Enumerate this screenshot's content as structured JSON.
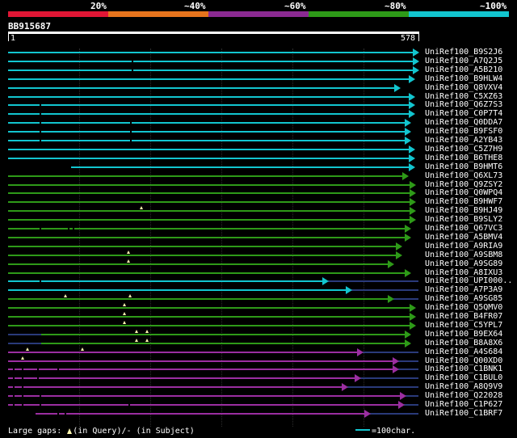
{
  "legend": {
    "labels": [
      "20%",
      "~40%",
      "~60%",
      "~80%",
      "~100%"
    ],
    "colors": [
      "#e01635",
      "#e6741d",
      "#8b2a92",
      "#2e9a18",
      "#12c5cf"
    ]
  },
  "query": {
    "id": "BB915687",
    "start_label": "1",
    "end_label": "578",
    "length": 578
  },
  "colors": {
    "cyan": "#12c5cf",
    "green": "#2e9a18",
    "magenta": "#9b2ea1",
    "tail": "#2a3a7a"
  },
  "hits": [
    {
      "id": "UniRef100_B9S2J6",
      "color": "cyan",
      "start": 1,
      "end": 578,
      "gaps": [],
      "qgaps": []
    },
    {
      "id": "UniRef100_A7Q2J5",
      "color": "cyan",
      "start": 1,
      "end": 578,
      "gaps": [
        175
      ],
      "qgaps": []
    },
    {
      "id": "UniRef100_A5B210",
      "color": "cyan",
      "start": 1,
      "end": 578,
      "gaps": [
        175
      ],
      "qgaps": []
    },
    {
      "id": "UniRef100_B9HLW4",
      "color": "cyan",
      "start": 1,
      "end": 572,
      "gaps": [],
      "qgaps": []
    },
    {
      "id": "UniRef100_Q8VXV4",
      "color": "cyan",
      "start": 1,
      "end": 552,
      "gaps": [],
      "qgaps": []
    },
    {
      "id": "UniRef100_C5XZ63",
      "color": "cyan",
      "start": 1,
      "end": 572,
      "gaps": [],
      "qgaps": []
    },
    {
      "id": "UniRef100_Q6Z7S3",
      "color": "cyan",
      "start": 1,
      "end": 572,
      "gaps": [
        45
      ],
      "qgaps": []
    },
    {
      "id": "UniRef100_C0P7T4",
      "color": "cyan",
      "start": 1,
      "end": 572,
      "gaps": [
        45
      ],
      "qgaps": []
    },
    {
      "id": "UniRef100_Q0DDA7",
      "color": "cyan",
      "start": 1,
      "end": 567,
      "gaps": [
        45,
        172
      ],
      "qgaps": []
    },
    {
      "id": "UniRef100_B9FSF0",
      "color": "cyan",
      "start": 1,
      "end": 567,
      "gaps": [
        45,
        172
      ],
      "qgaps": []
    },
    {
      "id": "UniRef100_A2YB43",
      "color": "cyan",
      "start": 1,
      "end": 567,
      "gaps": [
        45,
        172
      ],
      "qgaps": []
    },
    {
      "id": "UniRef100_C5Z7H9",
      "color": "cyan",
      "start": 1,
      "end": 572,
      "gaps": [],
      "qgaps": []
    },
    {
      "id": "UniRef100_B6THE8",
      "color": "cyan",
      "start": 1,
      "end": 572,
      "gaps": [],
      "qgaps": []
    },
    {
      "id": "UniRef100_B9HMT6",
      "color": "cyan",
      "start": 90,
      "end": 572,
      "gaps": [],
      "qgaps": []
    },
    {
      "id": "UniRef100_Q6XL73",
      "color": "green",
      "start": 1,
      "end": 563,
      "gaps": [],
      "qgaps": []
    },
    {
      "id": "UniRef100_Q9ZSY2",
      "color": "green",
      "start": 1,
      "end": 574,
      "gaps": [],
      "qgaps": []
    },
    {
      "id": "UniRef100_Q0WPQ4",
      "color": "green",
      "start": 1,
      "end": 574,
      "gaps": [],
      "qgaps": []
    },
    {
      "id": "UniRef100_B9HWF7",
      "color": "green",
      "start": 1,
      "end": 574,
      "gaps": [],
      "qgaps": []
    },
    {
      "id": "UniRef100_B9HJ49",
      "color": "green",
      "start": 1,
      "end": 574,
      "gaps": [],
      "qgaps": [
        188
      ]
    },
    {
      "id": "UniRef100_B9SLY2",
      "color": "green",
      "start": 1,
      "end": 574,
      "gaps": [],
      "qgaps": []
    },
    {
      "id": "UniRef100_Q67VC3",
      "color": "green",
      "start": 1,
      "end": 567,
      "gaps": [
        45,
        85,
        92
      ],
      "qgaps": []
    },
    {
      "id": "UniRef100_A5BMV4",
      "color": "green",
      "start": 1,
      "end": 567,
      "gaps": [],
      "qgaps": []
    },
    {
      "id": "UniRef100_A9RIA9",
      "color": "green",
      "start": 1,
      "end": 554,
      "gaps": [],
      "qgaps": []
    },
    {
      "id": "UniRef100_A9SBM8",
      "color": "green",
      "start": 1,
      "end": 554,
      "gaps": [],
      "qgaps": [
        170
      ]
    },
    {
      "id": "UniRef100_A9SG89",
      "color": "green",
      "start": 1,
      "end": 543,
      "gaps": [],
      "qgaps": [
        170
      ]
    },
    {
      "id": "UniRef100_A8IXU3",
      "color": "green",
      "start": 1,
      "end": 567,
      "gaps": [],
      "qgaps": []
    },
    {
      "id": "UniRef100_UPI000..",
      "color": "cyan",
      "start": 1,
      "end": 451,
      "gaps": [
        45
      ],
      "qgaps": [],
      "tail_end": 578
    },
    {
      "id": "UniRef100_A7P3A9",
      "color": "cyan",
      "start": 1,
      "end": 484,
      "gaps": [],
      "qgaps": [],
      "tail_end": 578
    },
    {
      "id": "UniRef100_A9SG85",
      "color": "green",
      "start": 1,
      "end": 543,
      "gaps": [],
      "qgaps": [
        82,
        172
      ],
      "tail_end": 578
    },
    {
      "id": "UniRef100_Q5QMV0",
      "color": "green",
      "start": 1,
      "end": 574,
      "gaps": [],
      "qgaps": [
        165
      ]
    },
    {
      "id": "UniRef100_B4FR07",
      "color": "green",
      "start": 1,
      "end": 574,
      "gaps": [],
      "qgaps": [
        165
      ]
    },
    {
      "id": "UniRef100_C5YPL7",
      "color": "green",
      "start": 1,
      "end": 574,
      "gaps": [],
      "qgaps": [
        165
      ]
    },
    {
      "id": "UniRef100_B9EX64",
      "color": "green",
      "start": 48,
      "end": 567,
      "gaps": [],
      "qgaps": [
        182,
        196
      ],
      "lead_start": 1
    },
    {
      "id": "UniRef100_B8A8X6",
      "color": "green",
      "start": 48,
      "end": 567,
      "gaps": [],
      "qgaps": [
        182,
        196
      ],
      "lead_start": 1
    },
    {
      "id": "UniRef100_A4S684",
      "color": "magenta",
      "start": 1,
      "end": 500,
      "gaps": [],
      "qgaps": [
        28,
        105
      ],
      "tail_end": 578
    },
    {
      "id": "UniRef100_Q00XD0",
      "color": "magenta",
      "start": 1,
      "end": 550,
      "gaps": [],
      "qgaps": [
        22
      ],
      "tail_end": 578
    },
    {
      "id": "UniRef100_C1BNK1",
      "color": "magenta",
      "start": 1,
      "end": 550,
      "gaps": [
        8,
        20,
        42,
        70
      ],
      "qgaps": [],
      "tail_end": 578
    },
    {
      "id": "UniRef100_C1BUL0",
      "color": "magenta",
      "start": 1,
      "end": 496,
      "gaps": [
        8,
        20,
        42
      ],
      "qgaps": [],
      "tail_end": 578
    },
    {
      "id": "UniRef100_A8Q9V9",
      "color": "magenta",
      "start": 1,
      "end": 478,
      "gaps": [
        8,
        20
      ],
      "qgaps": [],
      "tail_end": 578
    },
    {
      "id": "UniRef100_Q22028",
      "color": "magenta",
      "start": 1,
      "end": 560,
      "gaps": [
        8,
        20,
        45
      ],
      "qgaps": [],
      "tail_end": 578
    },
    {
      "id": "UniRef100_C1P627",
      "color": "magenta",
      "start": 1,
      "end": 558,
      "gaps": [
        8,
        20,
        45,
        170
      ],
      "qgaps": [],
      "tail_end": 578
    },
    {
      "id": "UniRef100_C1BRF7",
      "color": "magenta",
      "start": 40,
      "end": 510,
      "gaps": [
        70,
        80
      ],
      "qgaps": [],
      "tail_end": 578
    }
  ],
  "footer": {
    "large_gaps_label": "Large gaps:",
    "in_query_label": "(in Query)/",
    "in_subject_dash": "-",
    "in_subject_label": " (in Subject)",
    "scale_label": "=100char."
  }
}
